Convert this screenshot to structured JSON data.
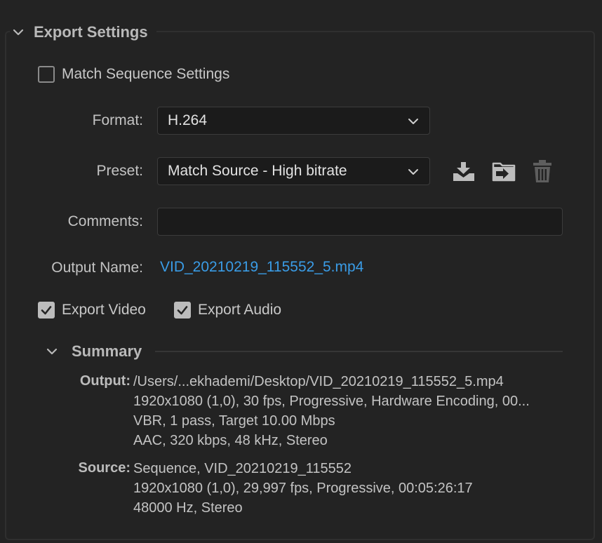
{
  "export_settings": {
    "title": "Export Settings",
    "match_sequence": {
      "label": "Match Sequence Settings",
      "checked": false
    },
    "format": {
      "label": "Format:",
      "value": "H.264"
    },
    "preset": {
      "label": "Preset:",
      "value": "Match Source - High bitrate"
    },
    "comments": {
      "label": "Comments:",
      "value": ""
    },
    "output_name": {
      "label": "Output Name:",
      "value": "VID_20210219_115552_5.mp4"
    },
    "export_video": {
      "label": "Export Video",
      "checked": true
    },
    "export_audio": {
      "label": "Export Audio",
      "checked": true
    }
  },
  "summary": {
    "title": "Summary",
    "output": {
      "label": "Output:",
      "lines": [
        "/Users/...ekhademi/Desktop/VID_20210219_115552_5.mp4",
        "1920x1080 (1,0), 30 fps, Progressive, Hardware Encoding, 00...",
        "VBR, 1 pass, Target 10.00 Mbps",
        "AAC, 320 kbps, 48 kHz, Stereo"
      ]
    },
    "source": {
      "label": "Source:",
      "lines": [
        "Sequence, VID_20210219_115552",
        "1920x1080 (1,0), 29,997 fps, Progressive, 00:05:26:17",
        "48000 Hz, Stereo"
      ]
    }
  },
  "icons": [
    "chevron-down-icon",
    "save-preset-icon",
    "import-preset-icon",
    "delete-preset-icon",
    "checkmark-icon"
  ],
  "colors": {
    "background": "#232323",
    "link": "#3a9ce6",
    "field_bg": "#1b1b1b"
  }
}
